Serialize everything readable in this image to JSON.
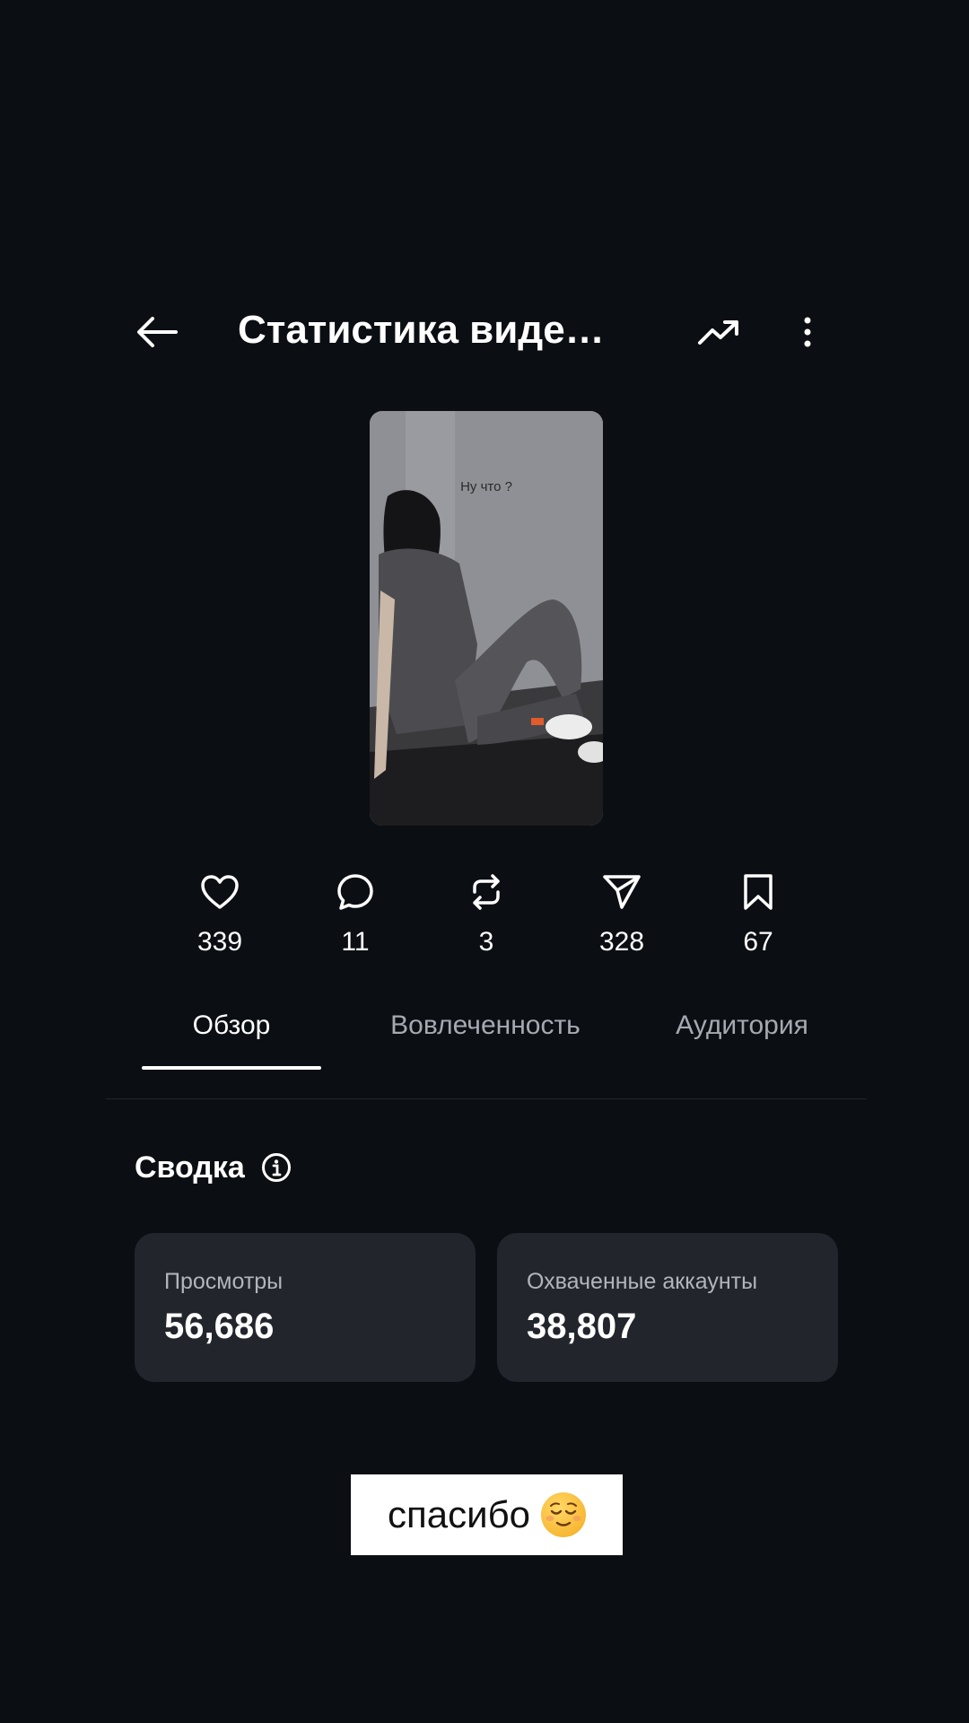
{
  "header": {
    "title": "Статистика виде…",
    "back_icon": "arrow-left-icon",
    "trend_icon": "trending-up-icon",
    "more_icon": "more-vertical-icon"
  },
  "video": {
    "caption": "Ну что ?"
  },
  "stats": [
    {
      "icon": "heart-icon",
      "value": "339"
    },
    {
      "icon": "comment-icon",
      "value": "11"
    },
    {
      "icon": "repost-icon",
      "value": "3"
    },
    {
      "icon": "share-icon",
      "value": "328"
    },
    {
      "icon": "bookmark-icon",
      "value": "67"
    }
  ],
  "tabs": [
    {
      "label": "Обзор",
      "active": true
    },
    {
      "label": "Вовлеченность",
      "active": false
    },
    {
      "label": "Аудитория",
      "active": false
    }
  ],
  "summary": {
    "title": "Сводка",
    "cards": [
      {
        "label": "Просмотры",
        "value": "56,686"
      },
      {
        "label": "Охваченные аккаунты",
        "value": "38,807"
      }
    ]
  },
  "sticker": {
    "text": "спасибо",
    "emoji": "relieved-face-emoji"
  },
  "colors": {
    "background": "#0b0e13",
    "card": "#22252c",
    "text_primary": "#ffffff",
    "text_secondary": "#a7a9b0"
  }
}
